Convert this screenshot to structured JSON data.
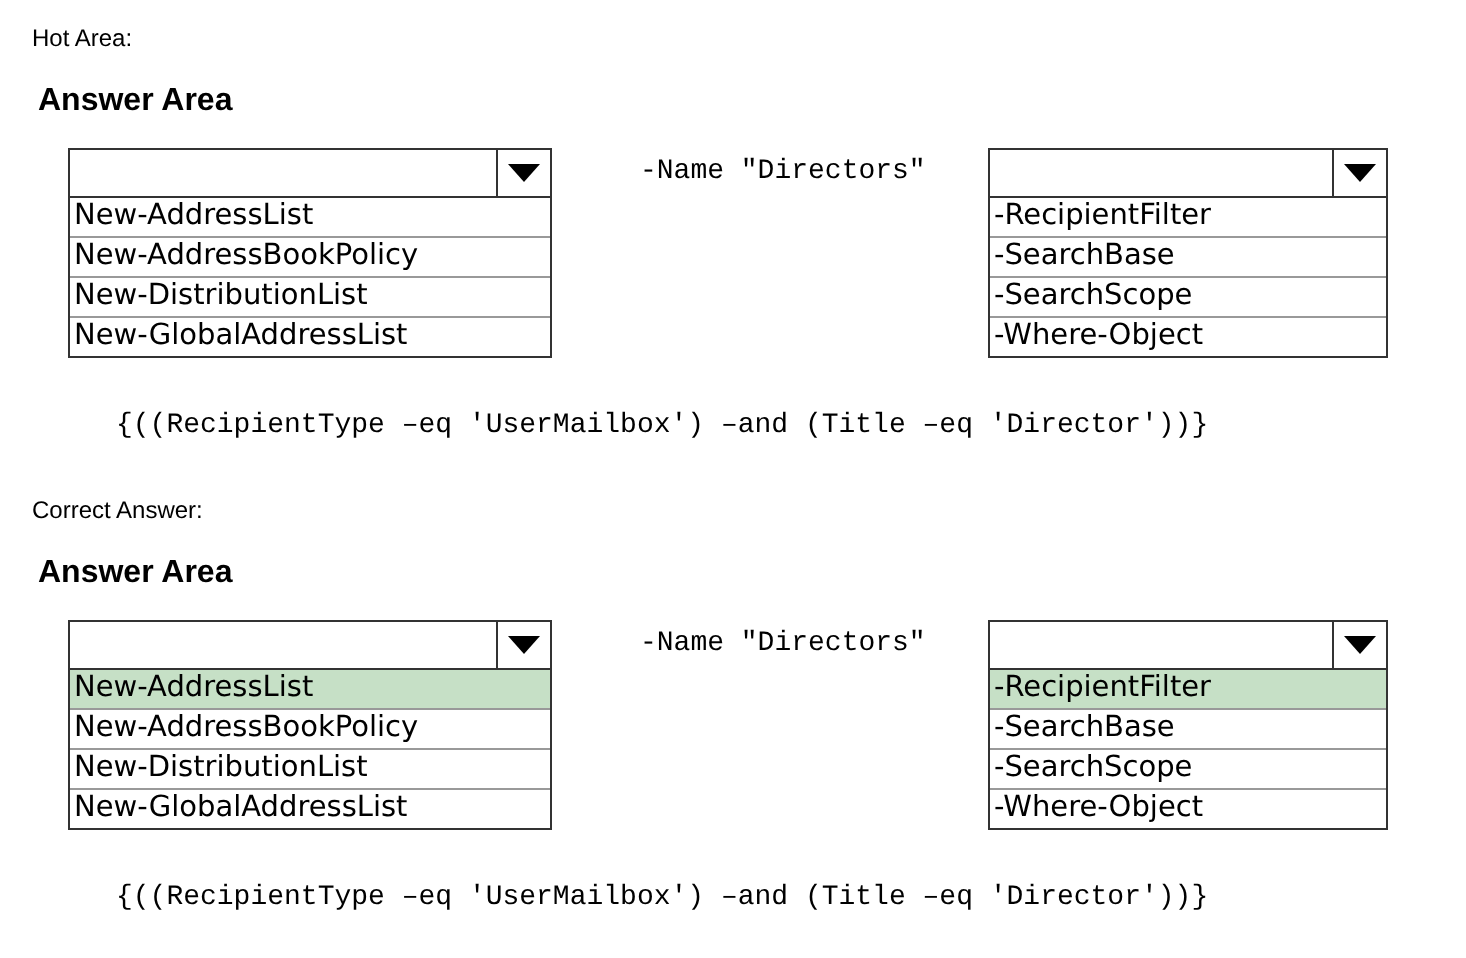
{
  "sections": [
    {
      "label": "Hot Area:",
      "heading": "Answer Area",
      "left_dropdown": {
        "options": [
          {
            "text": "New-AddressList",
            "selected": false
          },
          {
            "text": "New-AddressBookPolicy",
            "selected": false
          },
          {
            "text": "New-DistributionList",
            "selected": false
          },
          {
            "text": "New-GlobalAddressList",
            "selected": false
          }
        ]
      },
      "middle_text": "-Name \"Directors\"",
      "right_dropdown": {
        "options": [
          {
            "text": "-RecipientFilter",
            "selected": false
          },
          {
            "text": "-SearchBase",
            "selected": false
          },
          {
            "text": "-SearchScope",
            "selected": false
          },
          {
            "text": "-Where-Object",
            "selected": false
          }
        ]
      },
      "code": "{((RecipientType –eq 'UserMailbox') –and (Title –eq 'Director'))}"
    },
    {
      "label": "Correct Answer:",
      "heading": "Answer Area",
      "left_dropdown": {
        "options": [
          {
            "text": "New-AddressList",
            "selected": true
          },
          {
            "text": "New-AddressBookPolicy",
            "selected": false
          },
          {
            "text": "New-DistributionList",
            "selected": false
          },
          {
            "text": "New-GlobalAddressList",
            "selected": false
          }
        ]
      },
      "middle_text": "-Name \"Directors\"",
      "right_dropdown": {
        "options": [
          {
            "text": "-RecipientFilter",
            "selected": true
          },
          {
            "text": "-SearchBase",
            "selected": false
          },
          {
            "text": "-SearchScope",
            "selected": false
          },
          {
            "text": "-Where-Object",
            "selected": false
          }
        ]
      },
      "code": "{((RecipientType –eq 'UserMailbox') –and (Title –eq 'Director'))}"
    }
  ]
}
